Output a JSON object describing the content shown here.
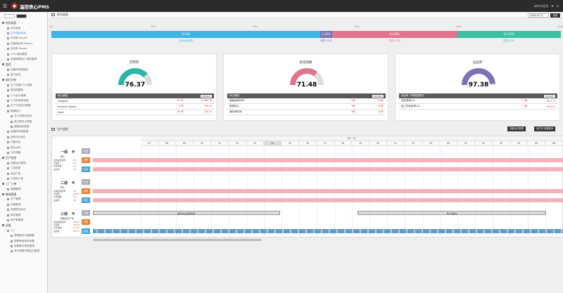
{
  "app": {
    "name": "温控表心PMS",
    "user": "admin先生"
  },
  "sidebar": {
    "tabs": [
      "1",
      "2"
    ],
    "items": [
      {
        "type": "group",
        "label": "综合画面"
      },
      {
        "type": "item",
        "label": "综合画面"
      },
      {
        "type": "item",
        "label": "生产综合状况",
        "active": true
      },
      {
        "type": "item",
        "label": "可用率 Report"
      },
      {
        "type": "item",
        "label": "性能指标率 Report"
      },
      {
        "type": "item",
        "label": "良品率 Report"
      },
      {
        "type": "item",
        "label": "CTQ 指标管理"
      },
      {
        "type": "item",
        "label": "相差报警统计 指标管理"
      },
      {
        "type": "group",
        "label": "监控"
      },
      {
        "type": "item",
        "label": "设备的机械监控"
      },
      {
        "type": "item",
        "label": "能力监控"
      },
      {
        "type": "group",
        "label": "执行分析"
      },
      {
        "type": "item",
        "label": "生产进度CTQ 把握"
      },
      {
        "type": "item",
        "label": "整体把握表"
      },
      {
        "type": "item",
        "label": "CTQ设计管理"
      },
      {
        "type": "item",
        "label": "CTQ的规律说明"
      },
      {
        "type": "item",
        "label": "生产中的走向把握"
      },
      {
        "type": "item",
        "label": "数据统计"
      },
      {
        "type": "item",
        "label": "生产的现状说明",
        "sub": true
      },
      {
        "type": "item",
        "label": "能力情况示意图",
        "sub": true
      },
      {
        "type": "item",
        "label": "偏差指标数据",
        "sub": true
      },
      {
        "type": "item",
        "label": "设备的机械数据"
      },
      {
        "type": "item",
        "label": "趋势分析统计"
      },
      {
        "type": "item",
        "label": "问题分析"
      },
      {
        "type": "item",
        "label": "相比分析"
      },
      {
        "type": "item",
        "label": "元件规格"
      },
      {
        "type": "group",
        "label": "生产信息"
      },
      {
        "type": "item",
        "label": "设备运行管理"
      },
      {
        "type": "item",
        "label": "工序报表"
      },
      {
        "type": "item",
        "label": "成品产量"
      },
      {
        "type": "item",
        "label": "半成品产量"
      },
      {
        "type": "group",
        "label": "工厂工单"
      },
      {
        "type": "item",
        "label": "数据管理"
      },
      {
        "type": "group",
        "label": "基础管理"
      },
      {
        "type": "item",
        "label": "生产管理"
      },
      {
        "type": "item",
        "label": "流程管理"
      },
      {
        "type": "item",
        "label": "设备情况启动"
      },
      {
        "type": "item",
        "label": "库存管理"
      },
      {
        "type": "item",
        "label": "用户表管理"
      },
      {
        "type": "group",
        "label": "设备"
      },
      {
        "type": "item",
        "label": "工厂"
      },
      {
        "type": "item",
        "label": "报警事件分组配置",
        "sub": true
      },
      {
        "type": "item",
        "label": "报警等级规则设置",
        "sub": true
      },
      {
        "type": "item",
        "label": "报警事件类型管理",
        "sub": true
      },
      {
        "type": "item",
        "label": "电气报警时限定点管理",
        "sub": true
      }
    ]
  },
  "header": {
    "title": "综合画面",
    "date": "2018-02-27",
    "search": "搜索"
  },
  "progress": {
    "ticks": [
      "0%",
      "20%",
      "40%",
      "60%",
      "80%",
      "100%"
    ],
    "segments": [
      {
        "label": "52.8%",
        "value": 52.8,
        "color": "#3db5e0",
        "caption": "当班运营效率"
      },
      {
        "label": "2.26%",
        "value": 2.26,
        "color": "#7a73b6",
        "caption": "故障 LOSS"
      },
      {
        "label": "24.58%",
        "value": 24.58,
        "color": "#e0758c",
        "caption": "性能 LOSS"
      },
      {
        "label": "20.36%",
        "value": 20.36,
        "color": "#3dbfa5",
        "caption": "性能 LOSS"
      }
    ]
  },
  "panels": [
    {
      "title": "可用率",
      "value": "76.37",
      "pct": 76.37,
      "color": "#2bb5a8",
      "table_title": "停止原因",
      "report": "REPORT",
      "rows": [
        [
          "Stopped",
          "59 秒",
          "0.589 分"
        ],
        [
          "External failure",
          "3 秒",
          "700 分"
        ],
        [
          "Hold",
          "89 秒",
          "126 分"
        ]
      ]
    },
    {
      "title": "表现指数",
      "value": "71.48",
      "pct": 71.48,
      "color": "#e0758c",
      "table_title": "停止原因",
      "report": "REPORT",
      "rows": [
        [
          "慢速运转时间",
          "5秒",
          "41秒"
        ],
        [
          "短暂停止",
          "3秒",
          "41秒"
        ],
        [
          "满负荷时间",
          "5秒",
          "41秒"
        ]
      ]
    },
    {
      "title": "良品率",
      "value": "97.38",
      "pct": 97.38,
      "color": "#7a73b6",
      "table_title": "良品率 下降原因概况",
      "report": "REPORT",
      "rows": [
        [
          "良品率低(%)",
          "三级",
          "58.1 %"
        ],
        [
          "返工的良品率(%)",
          "一级",
          "55.6 %"
        ]
      ]
    }
  ],
  "section": {
    "title": "生产监控",
    "btn1": "查看运行数据",
    "btn2": "待打印 查看程序"
  },
  "timeline": {
    "date": "02 - 27",
    "hours": [
      "07",
      "08",
      "09",
      "10",
      "11",
      "12",
      "13",
      "14",
      "15",
      "16",
      "17",
      "18",
      "19",
      "20",
      "21",
      "22",
      "23",
      "00",
      "01",
      "02",
      "03",
      "04",
      "05",
      "06"
    ],
    "lines": [
      {
        "name": "一线",
        "status": "停止",
        "metrics": [
          [
            "全体运营效率",
            "0%"
          ],
          [
            "可用率",
            "0%"
          ],
          [
            "表现指数",
            "0%"
          ],
          [
            "良品率",
            "0%"
          ]
        ],
        "kind": "pink"
      },
      {
        "name": "二线",
        "status": "停止",
        "metrics": [
          [
            "全体运营效率",
            "0%"
          ],
          [
            "可用率",
            "100%"
          ],
          [
            "表现指数",
            "0%"
          ],
          [
            "良品率",
            "0%"
          ]
        ],
        "kind": "pink"
      },
      {
        "name": "三线",
        "status": "良品化生产中",
        "metrics": [
          [
            "全体运营效率",
            "52.2%"
          ],
          [
            "可用率",
            "76.4%"
          ],
          [
            "表现指数",
            "71.5%"
          ],
          [
            "良品率",
            "98.7%"
          ]
        ],
        "kind": "mixed",
        "plan1": "备料中(设备运转前)",
        "plan2": "用心准备中"
      }
    ],
    "row_buttons": [
      "计划",
      "报警",
      "实绩"
    ]
  }
}
